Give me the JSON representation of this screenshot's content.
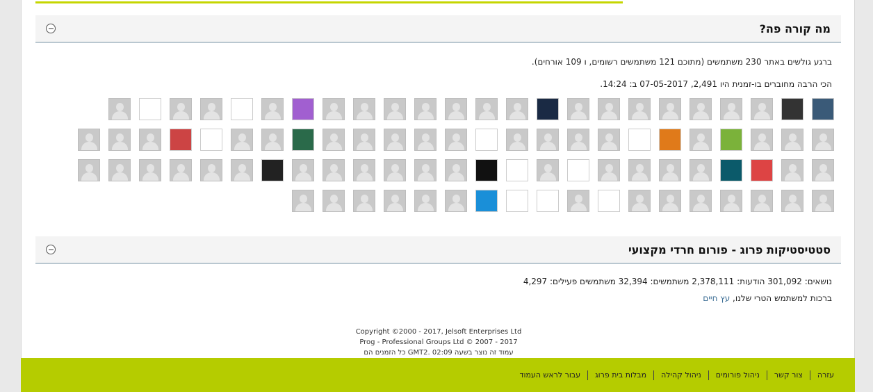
{
  "whats_going_on": {
    "title": "מה קורה פה?",
    "online_line": "ברגע גולשים באתר 230 משתמשים (מתוכם 121 משתמשים רשומים, ו 109 אורחים).",
    "record_line": "הכי הרבה מחוברים בו-זמנית היו 2,491, 07-05-2017 ב: 14:24."
  },
  "stats": {
    "title": "סטטיסטיקות פרוג - פורום חרדי מקצועי",
    "line": "נושאים: 301,092   הודעות: 2,378,111   משתמשים: 32,394   משתמשים פעילים: 4,297",
    "welcome_prefix": "ברכות למשתמש הטרי שלנו, ",
    "welcome_user": "עץ חיים"
  },
  "copyright": {
    "line1": "Copyright ©2000 - 2017, Jelsoft Enterprises Ltd",
    "line2": "Prog - Professional Groups Ltd © 2007 - 2017",
    "line3": "כל הזמנים הם GMT2. עמוד זה נוצר בשעה 02:09"
  },
  "footer_nav": [
    "עזרה",
    "צור קשר",
    "ניהול פורומים",
    "ניהול קהילה",
    "מבלות בית פרוג",
    "עבור לראש העמוד"
  ],
  "colors": {
    "accent": "#b5cc00",
    "link": "#3c6e95"
  }
}
